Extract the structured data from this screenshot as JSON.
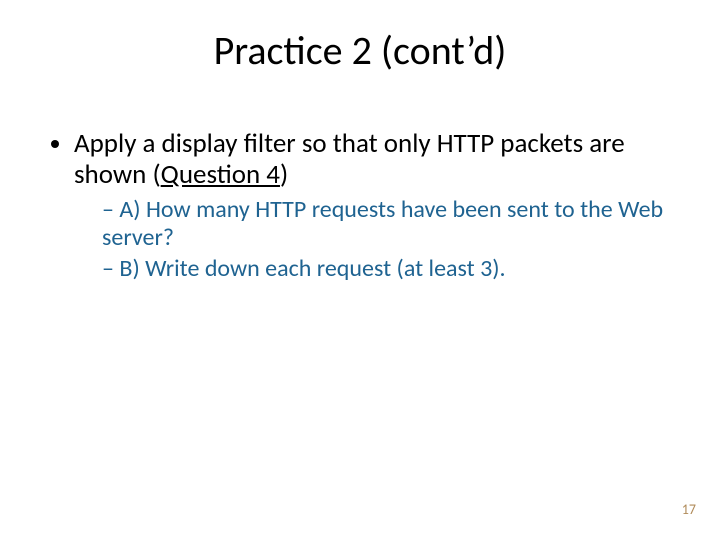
{
  "title": "Practice 2 (cont’d)",
  "bullet": {
    "text_before": "Apply a display filter so that only HTTP packets are shown (",
    "underlined": "Question 4",
    "text_after": ")"
  },
  "subbullets": [
    "A) How many HTTP requests have been sent to the Web server?",
    "B) Write down each request (at least 3)."
  ],
  "page_number": "17"
}
